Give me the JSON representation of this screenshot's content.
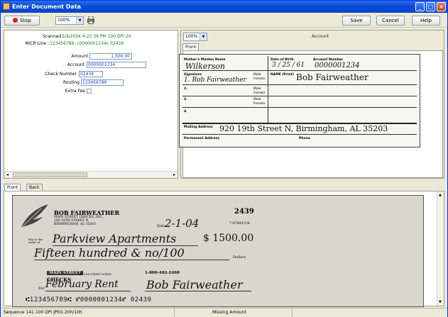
{
  "window": {
    "title": "Enter Document Data"
  },
  "toolbar": {
    "stop_label": "Stop",
    "zoom_value": "100%",
    "save_label": "Save",
    "cancel_label": "Cancel",
    "help_label": "Help"
  },
  "info": {
    "scanned_label": "Scanned",
    "scanned_value": "2/4/2004 4:22:39 PM  100 DPI  20",
    "micr_label": "MICR Line :",
    "micr_value": "123456789: c0000001234c 02439"
  },
  "fields": {
    "amount_label": "Amount",
    "amount_value": "1,500.00",
    "account_label": "Account",
    "account_value": "0000001234",
    "check_number_label": "Check Number",
    "check_number_value": "02439",
    "routing_label": "Routing",
    "routing_value": "123456789",
    "extra_fee_label": "Extra Fee"
  },
  "preview": {
    "zoom_value": "100%",
    "title": "Account",
    "tab_front": "Front"
  },
  "account_form": {
    "mothers_maiden_label": "Mother's Maiden Name",
    "mothers_maiden_value": "Wilkerson",
    "dob_label": "Date of Birth",
    "dob_value": "3 / 25 / 61",
    "account_number_label": "Account Number",
    "account_number_value": "0000001234",
    "signature_label": "Signature",
    "signature_value": "1. Bob Fairweather",
    "name_print_label": "NAME (Print)",
    "name_print_value": "Bob Fairweather",
    "row2": "2.",
    "row3": "3.",
    "row4": "4.",
    "male_label": "Male",
    "female_label": "Female",
    "mailing_label": "Mailing Address",
    "mailing_value": "920 19th Street N,  Birmingham, AL 35203",
    "permanent_label": "Permanent Address",
    "phone_label": "Phone"
  },
  "bottom_tabs": {
    "front": "Front",
    "back": "Back"
  },
  "check": {
    "company": "BOB FAIRWEATHER",
    "address1": "MAIN STREET CHECKS, INC.",
    "address2": "200 19TH STREET N.",
    "address3": "BIRMINGHAM, AL 35203",
    "number": "2439",
    "date_label": "Date",
    "date_value": "2-1-04",
    "fraction": "7-4789/1234",
    "payto_label": "Pay to the order of",
    "payee": "Parkview Apartments",
    "amount": "$ 1500.00",
    "words": "Fifteen hundred & no/100",
    "dollars_label": "Dollars",
    "bank_name": "MAIN STREET",
    "bank_sub": "CHECKS",
    "bank_addr": "100 19th STREET NORTH",
    "phone": "1-800-482-2468",
    "memo_label": "For",
    "memo": "February Rent",
    "signature": "Bob Fairweather",
    "micr": "⑆123456789⑆ ⑈0000001234⑈ 02439"
  },
  "status": {
    "left": "Sequence 141  100 DPI JPEG 20h/10h",
    "middle": "Missing Amount"
  },
  "colors": {
    "title_bar": "#0a4bd6",
    "stop_red": "#c62a1e",
    "field_text": "#1a3fbf"
  }
}
